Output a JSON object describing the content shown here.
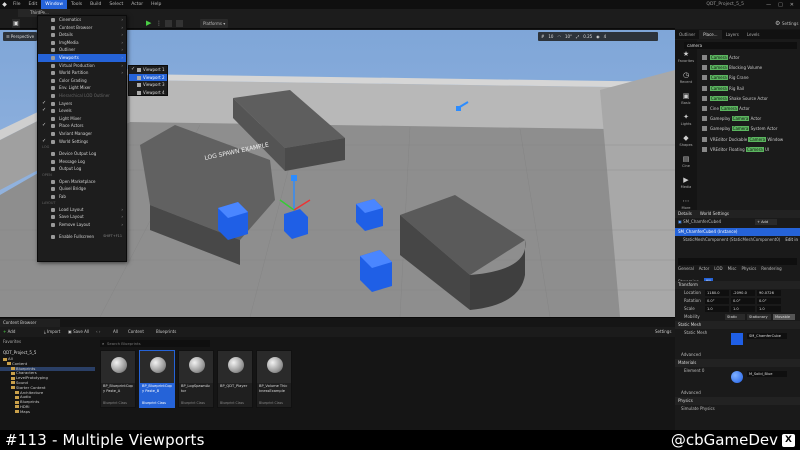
{
  "menubar": {
    "items": [
      "File",
      "Edit",
      "Window",
      "Tools",
      "Build",
      "Select",
      "Actor",
      "Help"
    ],
    "active": "Window",
    "project_title": "QDT_Project_5_5"
  },
  "toolbar": {
    "level_tab": "ThirdPe...",
    "platforms": "Platforms",
    "settings": "Settings"
  },
  "viewport": {
    "perspective": "Perspective",
    "floor_text": "LOG SPAWN EXAMPLE",
    "stats": [
      "10",
      "10°",
      "0.25",
      "4"
    ]
  },
  "window_menu": {
    "items": [
      {
        "label": "Cinematics",
        "arrow": true
      },
      {
        "label": "Content Browser",
        "arrow": true
      },
      {
        "label": "Details",
        "arrow": true
      },
      {
        "label": "ImgMedia",
        "arrow": true
      },
      {
        "label": "Outliner",
        "arrow": true
      },
      {
        "label": "Viewports",
        "arrow": true,
        "hover": true
      },
      {
        "label": "Virtual Production",
        "arrow": true
      },
      {
        "label": "World Partition",
        "arrow": true
      },
      {
        "label": "Color Grading"
      },
      {
        "label": "Env. Light Mixer"
      },
      {
        "label": "Hierarchical LOD Outliner",
        "disabled": true
      },
      {
        "label": "Layers",
        "check": true
      },
      {
        "label": "Levels",
        "check": true
      },
      {
        "label": "Light Mixer"
      },
      {
        "label": "Place Actors",
        "check": true
      },
      {
        "label": "Variant Manager"
      },
      {
        "label": "World Settings",
        "check": true
      },
      {
        "sep": "LOG"
      },
      {
        "label": "Device Output Log"
      },
      {
        "label": "Message Log"
      },
      {
        "label": "Output Log"
      },
      {
        "sep": "OPEN"
      },
      {
        "label": "Open Marketplace"
      },
      {
        "label": "Quixel Bridge"
      },
      {
        "label": "Fab"
      },
      {
        "sep": "LAYOUT"
      },
      {
        "label": "Load Layout",
        "arrow": true
      },
      {
        "label": "Save Layout",
        "arrow": true
      },
      {
        "label": "Remove Layout",
        "arrow": true
      },
      {
        "sep": ""
      },
      {
        "label": "Enable Fullscreen",
        "shortcut": "SHIFT+F11"
      }
    ]
  },
  "viewports_submenu": {
    "items": [
      {
        "label": "Viewport 1",
        "check": true
      },
      {
        "label": "Viewport 2",
        "hover": true
      },
      {
        "label": "Viewport 3"
      },
      {
        "label": "Viewport 4"
      }
    ]
  },
  "outliner": {
    "tabs": [
      "Outliner",
      "Place...",
      "Layers",
      "Levels"
    ],
    "search": "camera",
    "rail": [
      "Favorites",
      "Recent",
      "Basic",
      "Lights",
      "Shapes",
      "Cine",
      "Media",
      "More"
    ],
    "rows": [
      {
        "pre": "",
        "hl": "Camera",
        "post": " Actor"
      },
      {
        "pre": "",
        "hl": "Camera",
        "post": " Blocking Volume"
      },
      {
        "pre": "",
        "hl": "Camera",
        "post": " Rig Crane"
      },
      {
        "pre": "",
        "hl": "Camera",
        "post": " Rig Rail"
      },
      {
        "pre": "",
        "hl": "Camera",
        "post": " Shake Source Actor"
      },
      {
        "pre": "Cine ",
        "hl": "Camera",
        "post": " Actor"
      },
      {
        "pre": "Gameplay ",
        "hl": "Camera",
        "post": " Actor"
      },
      {
        "pre": "Gameplay ",
        "hl": "Camera",
        "post": " System Actor"
      },
      {
        "pre": "VREditor Dockable ",
        "hl": "Camera",
        "post": " Window"
      },
      {
        "pre": "VREditor Floating ",
        "hl": "Camera",
        "post": " UI"
      }
    ]
  },
  "details": {
    "tabs": [
      "Details",
      "World Settings"
    ],
    "object": "SM_ChamferCube4",
    "add": "Add",
    "instance": "SM_ChamferCube4 (Instance)",
    "component": "StaticMeshComponent (StaticMeshComponent0)",
    "edit_in": "Edit in",
    "filter_tabs": [
      "General",
      "Actor",
      "LOD",
      "Misc",
      "Physics",
      "Rendering",
      "Streaming",
      "All"
    ],
    "transform": "Transform",
    "location": {
      "label": "Location",
      "x": "1180.0",
      "y": "-2090.0",
      "z": "90.0726"
    },
    "rotation": {
      "label": "Rotation",
      "x": "0.0°",
      "y": "0.0°",
      "z": "0.0°"
    },
    "scale": {
      "label": "Scale",
      "x": "1.0",
      "y": "1.0",
      "z": "1.0"
    },
    "mobility": {
      "label": "Mobility",
      "options": [
        "Static",
        "Stationary",
        "Movable"
      ]
    },
    "static_mesh": "Static Mesh",
    "static_mesh_value": "SM_ChamferCube",
    "advanced": "Advanced",
    "materials": "Materials",
    "element": "Element 0",
    "material_value": "M_Solid_Blue",
    "physics": "Physics",
    "simulate": "Simulate Physics"
  },
  "content_browser": {
    "tab": "Content Browser",
    "add": "Add",
    "import": "Import",
    "save_all": "Save All",
    "path": [
      "All",
      "Content",
      "Blueprints"
    ],
    "settings": "Settings",
    "favorites": "Favorites",
    "project": "QDT_Project_5_5",
    "search_placeholder": "Search Blueprints",
    "tree": [
      "All",
      "Content",
      "Blueprints",
      "Characters",
      "LevelPrototyping",
      "Sound",
      "Starter Content",
      "Architecture",
      "Audio",
      "Blueprints",
      "HDRI",
      "Maps"
    ],
    "assets": [
      {
        "name": "BP_BlueprintCopy Paste_A",
        "type": "Blueprint Class"
      },
      {
        "name": "BP_BlueprintCopy Paste_B",
        "type": "Blueprint Class",
        "selected": true
      },
      {
        "name": "BP_LogSpawnActor",
        "type": "Blueprint Class"
      },
      {
        "name": "BP_QDT_Player",
        "type": "Blueprint Class"
      },
      {
        "name": "BP_Volume ThicknessExample",
        "type": "Blueprint Class"
      }
    ]
  },
  "caption": {
    "title": "#113 - Multiple Viewports",
    "handle": "@cbGameDev",
    "x": "X"
  },
  "colors": {
    "accent": "#2563d8",
    "highlight": "#5bb55f",
    "floor": "#9a9a9a",
    "cube": "#1f5fe6"
  }
}
